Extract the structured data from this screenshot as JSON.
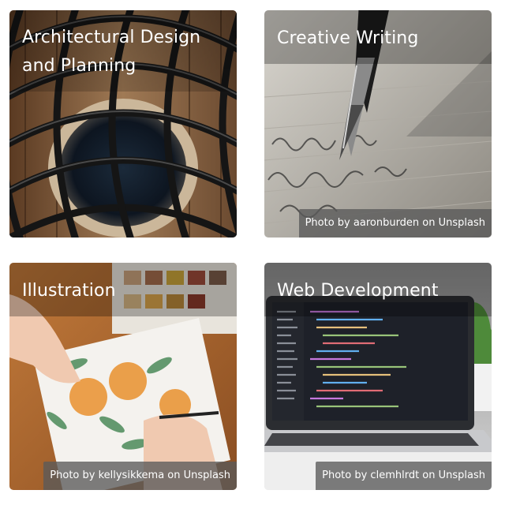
{
  "cards": [
    {
      "title": "Architectural Design and Planning",
      "credit": ""
    },
    {
      "title": "Creative Writing",
      "credit": "Photo by aaronburden on Unsplash"
    },
    {
      "title": "Illustration",
      "credit": "Photo by kellysikkema on Unsplash"
    },
    {
      "title": "Web Development",
      "credit": "Photo by clemhlrdt on Unsplash"
    }
  ],
  "icons": {
    "card_1": "architecture-lattice-photo",
    "card_2": "fountain-pen-photo",
    "card_3": "watercolor-oranges-photo",
    "card_4": "laptop-code-photo"
  }
}
